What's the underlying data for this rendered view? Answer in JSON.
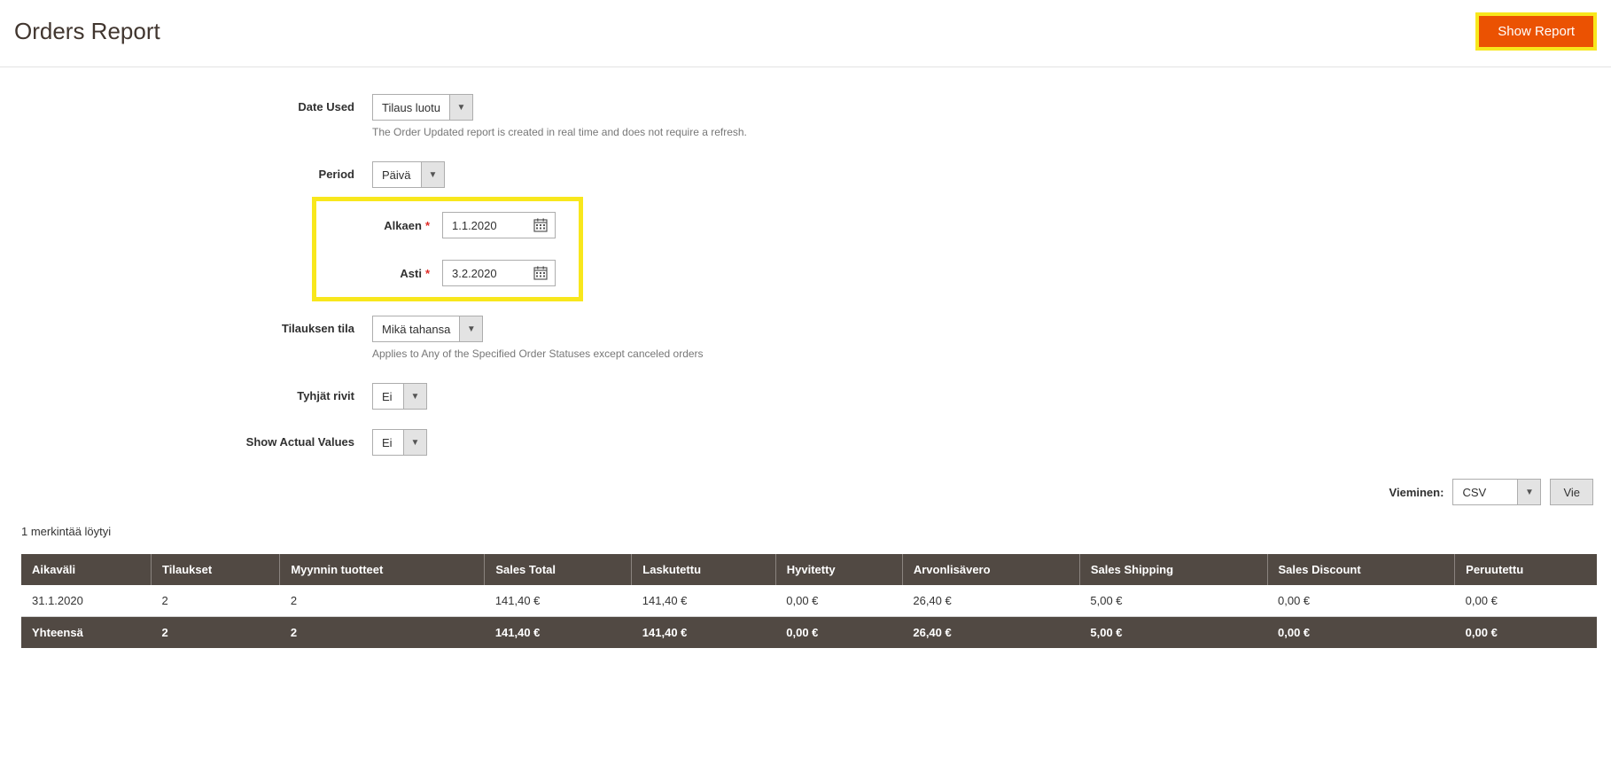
{
  "header": {
    "title": "Orders Report",
    "show_report": "Show Report"
  },
  "filters": {
    "date_used": {
      "label": "Date Used",
      "value": "Tilaus luotu",
      "note": "The Order Updated report is created in real time and does not require a refresh."
    },
    "period": {
      "label": "Period",
      "value": "Päivä"
    },
    "from": {
      "label": "Alkaen",
      "value": "1.1.2020"
    },
    "to": {
      "label": "Asti",
      "value": "3.2.2020"
    },
    "order_status": {
      "label": "Tilauksen tila",
      "value": "Mikä tahansa",
      "note": "Applies to Any of the Specified Order Statuses except canceled orders"
    },
    "empty_rows": {
      "label": "Tyhjät rivit",
      "value": "Ei"
    },
    "actual_values": {
      "label": "Show Actual Values",
      "value": "Ei"
    }
  },
  "export": {
    "label": "Vieminen:",
    "format": "CSV",
    "button": "Vie"
  },
  "records_found": "1 merkintää löytyi",
  "table": {
    "columns": [
      "Aikaväli",
      "Tilaukset",
      "Myynnin tuotteet",
      "Sales Total",
      "Laskutettu",
      "Hyvitetty",
      "Arvonlisävero",
      "Sales Shipping",
      "Sales Discount",
      "Peruutettu"
    ],
    "rows": [
      {
        "c": [
          "31.1.2020",
          "2",
          "2",
          "141,40 €",
          "141,40 €",
          "0,00 €",
          "26,40 €",
          "5,00 €",
          "0,00 €",
          "0,00 €"
        ]
      }
    ],
    "total": {
      "c": [
        "Yhteensä",
        "2",
        "2",
        "141,40 €",
        "141,40 €",
        "0,00 €",
        "26,40 €",
        "5,00 €",
        "0,00 €",
        "0,00 €"
      ]
    }
  }
}
